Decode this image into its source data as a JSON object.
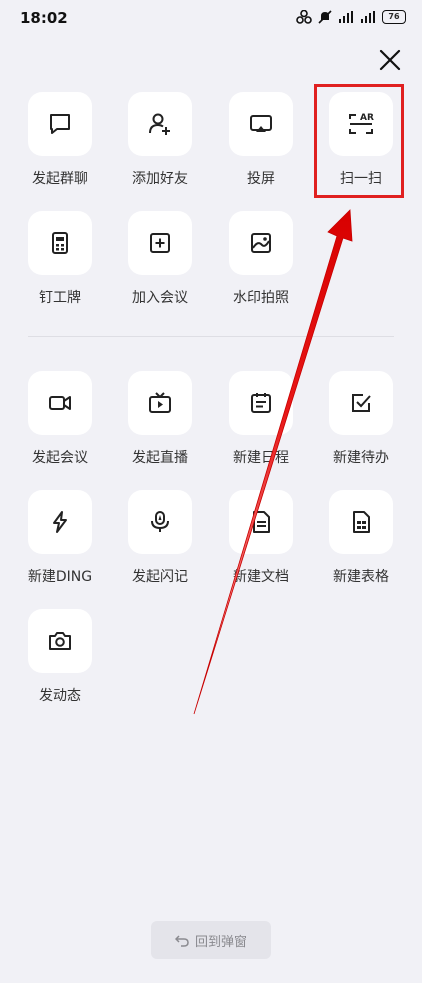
{
  "status_bar": {
    "time": "18:02",
    "battery": "76"
  },
  "grid_top": [
    {
      "label": "发起群聊",
      "icon": "chat-bubble-icon"
    },
    {
      "label": "添加好友",
      "icon": "add-friend-icon"
    },
    {
      "label": "投屏",
      "icon": "screen-cast-icon"
    },
    {
      "label": "扫一扫",
      "icon": "scan-ar-icon"
    },
    {
      "label": "钉工牌",
      "icon": "badge-icon"
    },
    {
      "label": "加入会议",
      "icon": "plus-square-icon"
    },
    {
      "label": "水印拍照",
      "icon": "watermark-photo-icon"
    }
  ],
  "grid_bottom": [
    {
      "label": "发起会议",
      "icon": "video-camera-icon"
    },
    {
      "label": "发起直播",
      "icon": "tv-live-icon"
    },
    {
      "label": "新建日程",
      "icon": "calendar-icon"
    },
    {
      "label": "新建待办",
      "icon": "checkbox-icon"
    },
    {
      "label": "新建DING",
      "icon": "lightning-icon"
    },
    {
      "label": "发起闪记",
      "icon": "mic-ai-icon"
    },
    {
      "label": "新建文档",
      "icon": "document-icon"
    },
    {
      "label": "新建表格",
      "icon": "spreadsheet-icon"
    },
    {
      "label": "发动态",
      "icon": "camera-icon"
    }
  ],
  "back_button": {
    "label": "回到弹窗",
    "icon": "undo-arrow-icon"
  },
  "annotation": {
    "highlight_color": "#e02020",
    "arrow_color": "#e02020"
  }
}
